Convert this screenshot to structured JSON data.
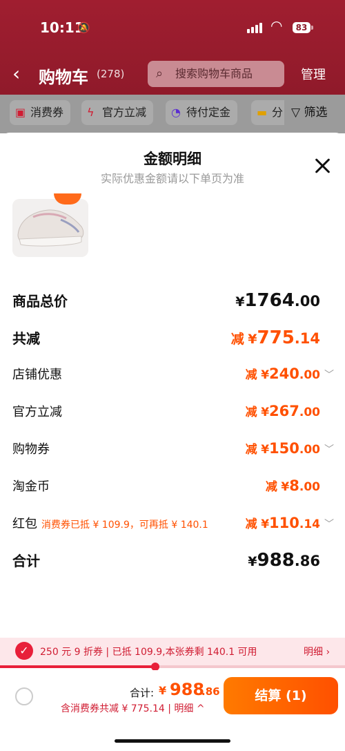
{
  "status_bar": {
    "time": "10:11",
    "battery": "83"
  },
  "nav": {
    "back": "‹",
    "title": "购物车",
    "count": "(278)",
    "search_placeholder": "搜索购物车商品",
    "manage": "管理"
  },
  "filters": {
    "chips": [
      {
        "label": "消费券"
      },
      {
        "label": "官方立减"
      },
      {
        "label": "待付定金"
      },
      {
        "label": "分"
      }
    ],
    "filter_label": "筛选"
  },
  "sheet": {
    "title": "金额明细",
    "subtitle": "实际优惠金额请以下单页为准"
  },
  "rows": [
    {
      "label": "商品总价",
      "prefix": "",
      "currency": "¥",
      "int": "1764",
      "dec": ".00"
    },
    {
      "label": "共减",
      "prefix": "减",
      "currency": "¥",
      "int": "775",
      "dec": ".14"
    },
    {
      "label": "店铺优惠",
      "prefix": "减",
      "currency": "¥",
      "int": "240",
      "dec": ".00"
    },
    {
      "label": "官方立减",
      "prefix": "减",
      "currency": "¥",
      "int": "267",
      "dec": ".00"
    },
    {
      "label": "购物券",
      "prefix": "减",
      "currency": "¥",
      "int": "150",
      "dec": ".00"
    },
    {
      "label": "淘金币",
      "prefix": "减",
      "currency": "¥",
      "int": "8",
      "dec": ".00"
    },
    {
      "label": "红包",
      "note": "消费券已抵 ¥ 109.9，可再抵 ¥ 140.1",
      "prefix": "减",
      "currency": "¥",
      "int": "110",
      "dec": ".14"
    },
    {
      "label": "合计",
      "prefix": "",
      "currency": "¥",
      "int": "988",
      "dec": ".86"
    }
  ],
  "coupon_bar": {
    "text": "250 元 9 折券 | 已抵 109.9,本张券剩 140.1 可用",
    "detail": "明细 ›",
    "progress": 0.45
  },
  "checkout": {
    "total_label": "合计:",
    "currency": "¥",
    "total_int": "988",
    "total_dec": ".86",
    "saving_text": "含消费券共减 ¥ 775.14 | 明细 ^",
    "pay_button": "结算 (1)"
  },
  "colors": {
    "accent": "#ff5000",
    "brand_red": "#e8203a",
    "header_bg": "#8f1a2a"
  },
  "icons": [
    "bell-slash-icon",
    "signal-icon",
    "wifi-icon",
    "search-icon",
    "coupon-icon",
    "flash-icon",
    "clock-icon",
    "folder-icon",
    "filter-icon",
    "close-icon",
    "chevron-down-icon",
    "checkmark-icon"
  ]
}
